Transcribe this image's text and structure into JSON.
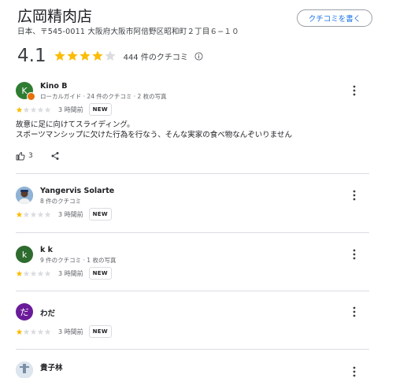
{
  "header": {
    "title": "広岡精肉店",
    "address": "日本、〒545-0011 大阪府大阪市阿倍野区昭和町２丁目６−１０",
    "write_review_label": "クチコミを書く"
  },
  "summary": {
    "rating": "4.1",
    "stars_filled": 4,
    "review_count_label": "444 件のクチコミ"
  },
  "reviews": [
    {
      "avatar_letter": "K",
      "avatar_color": "#2e7d32",
      "name": "Kino B",
      "meta": "ローカルガイド · 24 件のクチコミ · 2 枚の写真",
      "stars": 1,
      "when": "3 時間前",
      "badge": "NEW",
      "text_line1": "故意に足に向けてスライディング。",
      "text_line2": "スポーツマンシップに欠けた行為を行なう、そんな実家の食べ物なんぞいりません",
      "likes": "3"
    },
    {
      "avatar_letter": "",
      "avatar_color": "#6d8fb0",
      "name": "Yangervis Solarte",
      "meta": "8 件のクチコミ",
      "stars": 1,
      "when": "3 時間前",
      "badge": "NEW"
    },
    {
      "avatar_letter": "k",
      "avatar_color": "#2e6b2e",
      "name": "k k",
      "meta": "9 件のクチコミ · 1 枚の写真",
      "stars": 1,
      "when": "3 時間前",
      "badge": "NEW"
    },
    {
      "avatar_letter": "だ",
      "avatar_color": "#6a1b9a",
      "name": "わだ",
      "meta": "",
      "stars": 1,
      "when": "3 時間前",
      "badge": "NEW"
    },
    {
      "avatar_letter": "",
      "avatar_color": "#b8c8d8",
      "name": "貴子林"
    }
  ],
  "colors": {
    "star_filled": "#fbbc04",
    "star_empty": "#dadce0",
    "accent": "#1a73e8"
  }
}
